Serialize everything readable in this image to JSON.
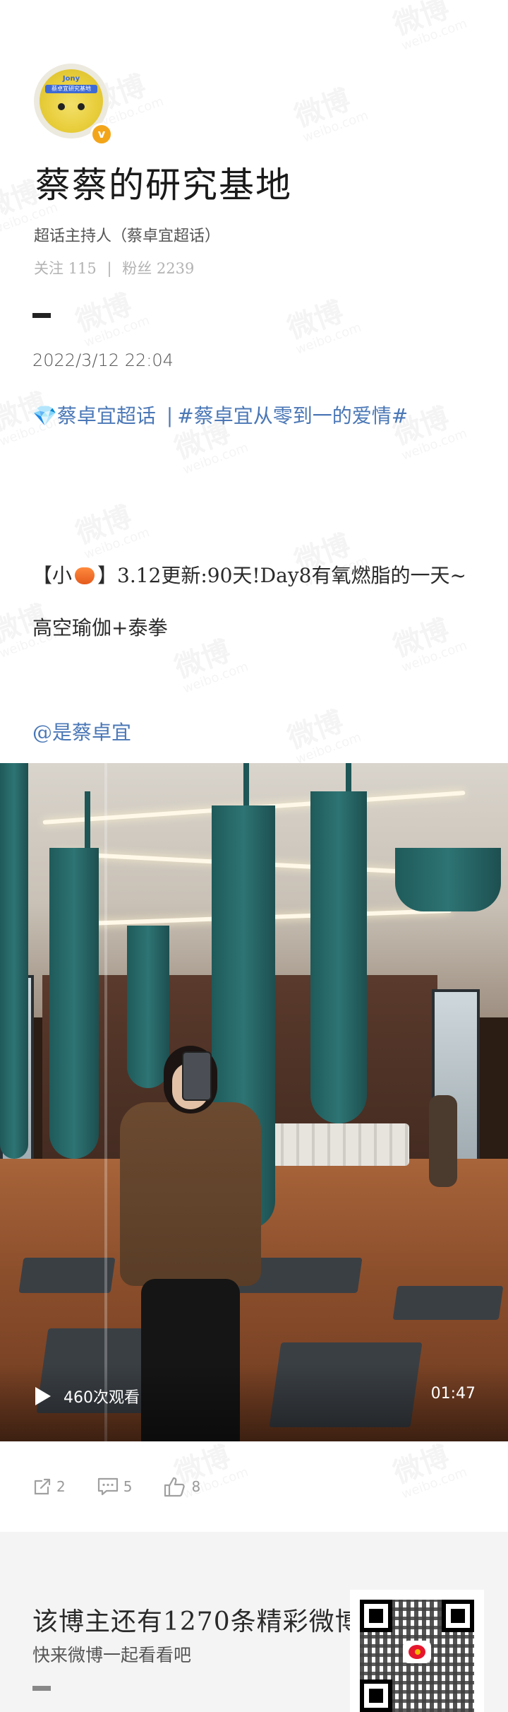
{
  "watermark": {
    "brand": "微博",
    "domain": "weibo.com"
  },
  "profile": {
    "avatar_text": "Jony",
    "avatar_subtext": "蔡卓宜研究基地",
    "verified_symbol": "v",
    "name": "蔡蔡的研究基地",
    "subtitle": "超话主持人（蔡卓宜超话）",
    "follow_label": "关注",
    "follow_count": "115",
    "fans_label": "粉丝",
    "fans_count": "2239"
  },
  "post": {
    "timestamp": "2022/3/12 22:04",
    "topic_prefix": "💎",
    "topic_super": "蔡卓宜超话",
    "topic_separator": "|",
    "topic_hashtag": "#蔡卓宜从零到一的爱情#",
    "content_prefix": "【小",
    "content_main": "】3.12更新:90天!Day8有氧燃脂的一天~高空瑜伽+泰拳",
    "mention": "@是蔡卓宜"
  },
  "video": {
    "views": "460次观看",
    "duration": "01:47"
  },
  "actions": {
    "share_count": "2",
    "comment_count": "5",
    "like_count": "8"
  },
  "promo": {
    "title": "该博主还有1270条精彩微博",
    "subtitle": "快来微博一起看看吧"
  },
  "colors": {
    "link": "#4a77b6",
    "verified": "#f3a51a",
    "weibo_red": "#e6162d"
  }
}
